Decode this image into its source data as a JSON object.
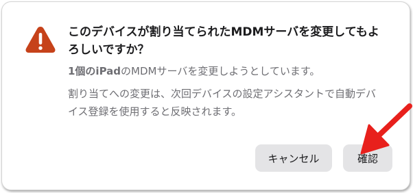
{
  "dialog": {
    "title": "このデバイスが割り当てられたMDMサーバを変更してもよろしいですか？",
    "message_count": "1個のiPad",
    "message_rest": "のMDMサーバを変更しようとしています。",
    "message_detail": "割り当てへの変更は、次回デバイスの設定アシスタントで自動デバイス登録を使用すると反映されます。",
    "icon": "warning-triangle-icon",
    "icon_color": "#c6421a",
    "cancel_label": "キャンセル",
    "confirm_label": "確認"
  },
  "annotation": {
    "arrow_icon": "red-arrow-icon",
    "arrow_color": "#e8201c"
  }
}
